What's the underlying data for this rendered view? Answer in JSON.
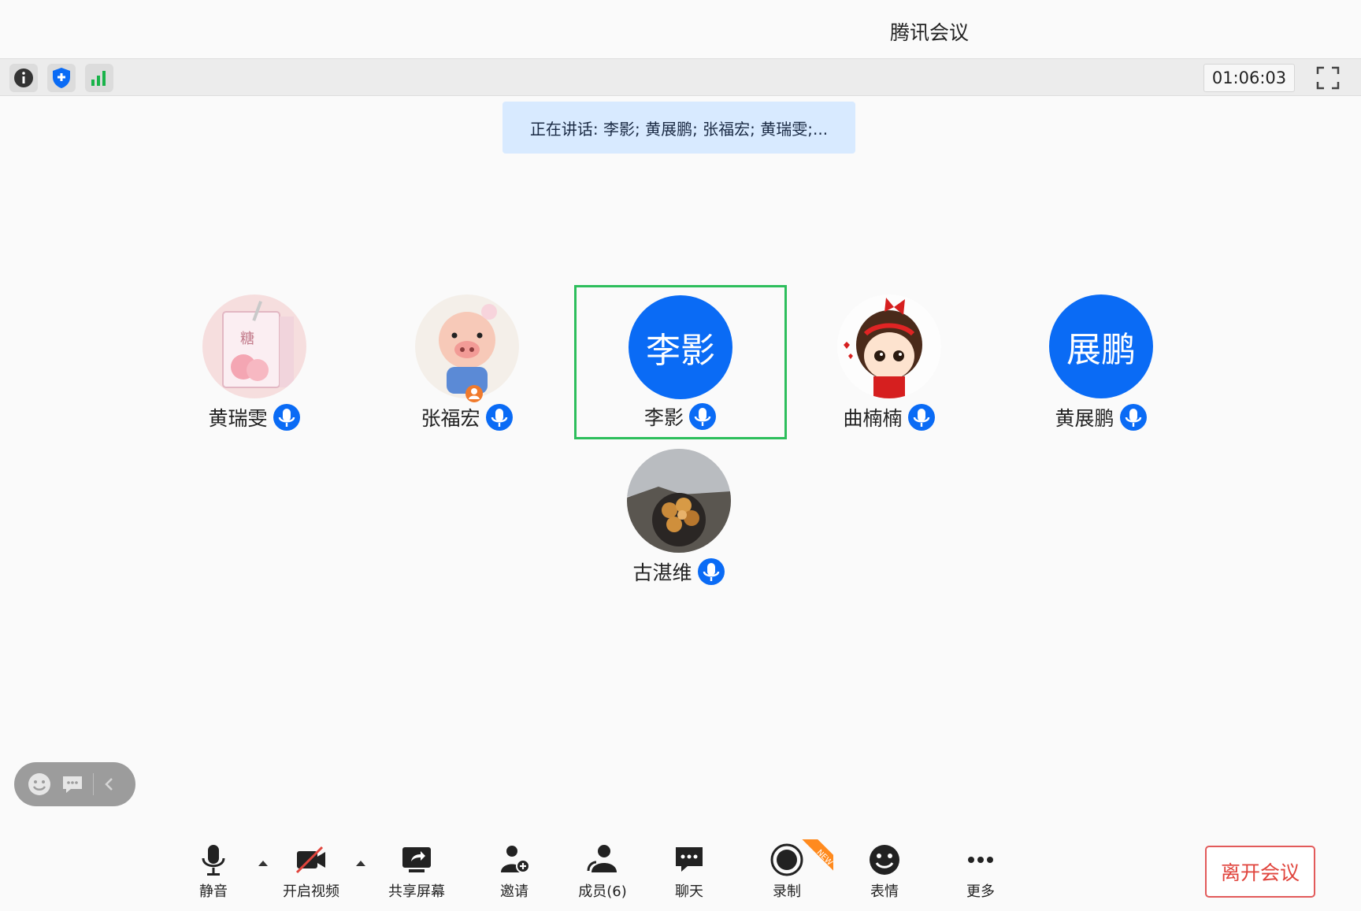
{
  "window": {
    "title": "腾讯会议"
  },
  "infobar": {
    "icons": [
      "info-icon",
      "shield-icon",
      "signal-icon"
    ],
    "timer": "01:06:03"
  },
  "speaking_banner": "正在讲话: 李影; 黄展鹏; 张福宏; 黄瑞雯;...",
  "participants": [
    {
      "name": "黄瑞雯",
      "avatar": "juice-box-sticker",
      "avatar_text": ""
    },
    {
      "name": "张福宏",
      "avatar": "pig-cartoon",
      "avatar_text": ""
    },
    {
      "name": "李影",
      "avatar": "initials",
      "avatar_text": "李影",
      "active": true
    },
    {
      "name": "曲楠楠",
      "avatar": "girl-cartoon",
      "avatar_text": ""
    },
    {
      "name": "黄展鹏",
      "avatar": "initials",
      "avatar_text": "展鹏"
    },
    {
      "name": "古湛维",
      "avatar": "flower-bouquet-photo",
      "avatar_text": ""
    }
  ],
  "float_pill": {
    "icons": [
      "emoji-icon",
      "chat-bubble-icon",
      "chevron-left-icon"
    ]
  },
  "toolbar": {
    "mute": "静音",
    "video": "开启视频",
    "share": "共享屏幕",
    "invite": "邀请",
    "members": "成员(6)",
    "chat": "聊天",
    "record": "录制",
    "record_badge": "NEW",
    "emoji": "表情",
    "more": "更多",
    "leave": "离开会议"
  },
  "colors": {
    "accent_blue": "#0a6bf5",
    "active_border": "#2dbe5c",
    "leave_red": "#e0443c",
    "banner_bg": "#d8eaff"
  }
}
